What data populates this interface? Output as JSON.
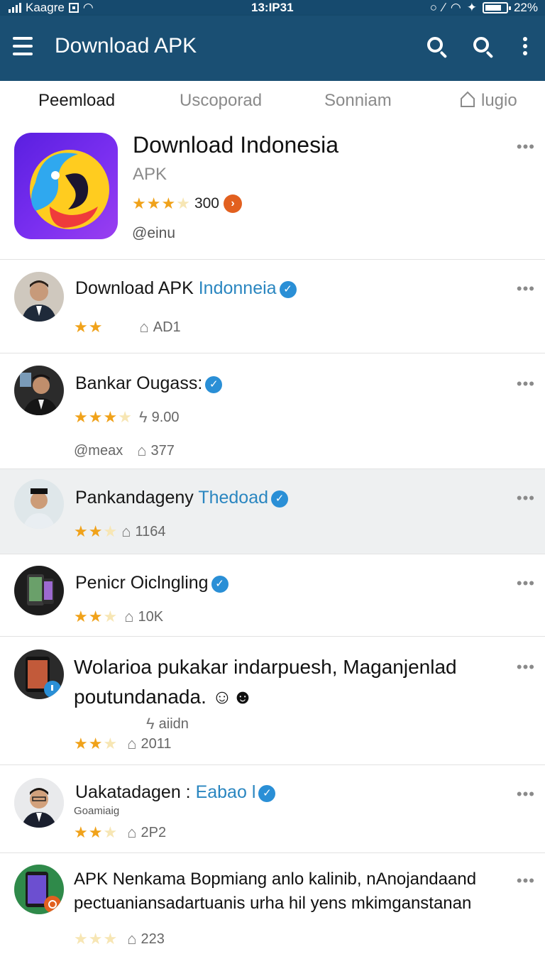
{
  "status_bar": {
    "carrier": "Kaagre",
    "time": "13:IP31",
    "battery": "22%"
  },
  "app_bar": {
    "title": "Download APK"
  },
  "tabs": [
    {
      "label": "Peemload"
    },
    {
      "label": "Uscoporad"
    },
    {
      "label": "Sonniam"
    },
    {
      "label": "lugio"
    }
  ],
  "app": {
    "name": "Download  Indonesia",
    "subtitle": "APK",
    "rating_count": "300",
    "developer": "@einu",
    "stars": 3
  },
  "items": [
    {
      "title": "Download APK",
      "accent": "Indonneia",
      "stars": 2,
      "stat": "AD1"
    },
    {
      "title": "Bankar Ougass:",
      "accent": "",
      "stars": 3,
      "stat_a": "9.00",
      "handle": "@meax",
      "stat_b": "377"
    },
    {
      "title": "Pankandageny",
      "accent": "Thedoad",
      "stars": 2,
      "stat": "1164"
    },
    {
      "title": "Penicr Oiclngling",
      "accent": "",
      "stars": 2,
      "stat": "10K"
    },
    {
      "title": "Wolarioa pukakar indarpuesh, Maganjenlad poutundanada.",
      "stars": 2,
      "stat_a": "aiidn",
      "stat_b": "2011"
    },
    {
      "title": "Uakatadagen :",
      "accent": "Eabao l",
      "subtitle": "Goamiaig",
      "stars": 2,
      "stat": "2P2"
    },
    {
      "title": "APK Nenkama Bopmiang anlo kalinib, nAnojandaand pectuaniansadartuanis urha hil yens mkimganstanan",
      "stars": 0,
      "stat": "223"
    }
  ]
}
